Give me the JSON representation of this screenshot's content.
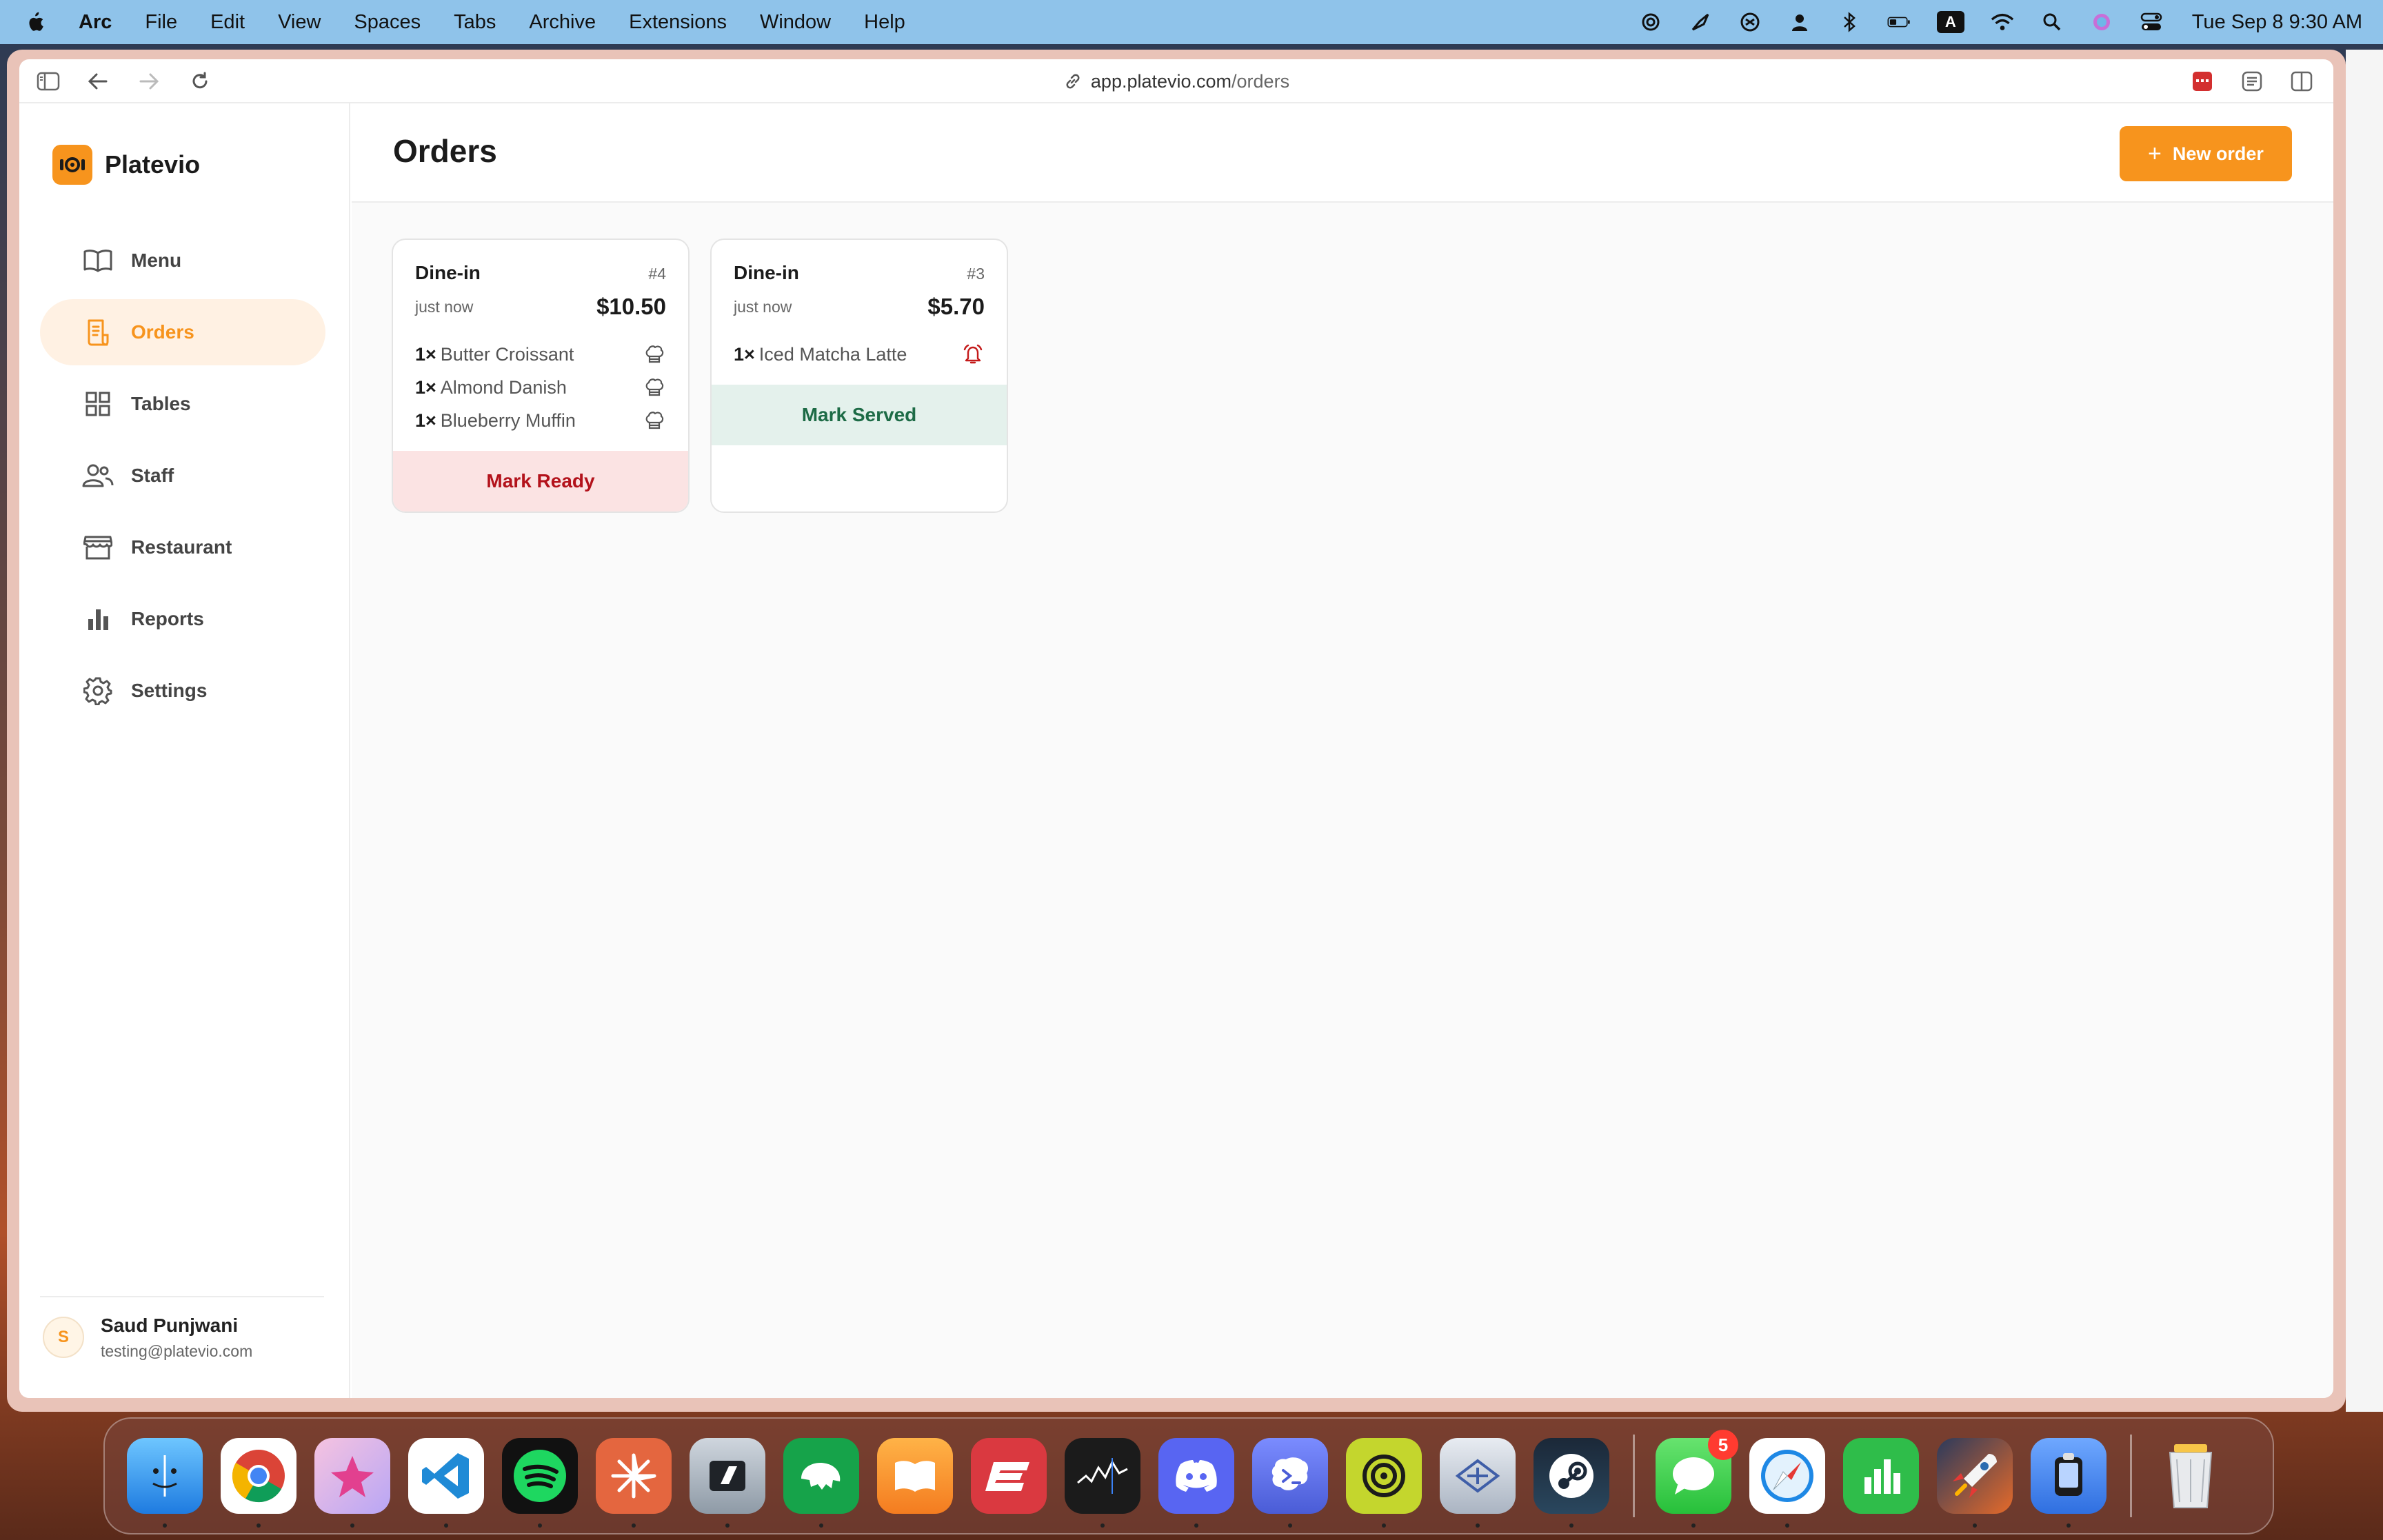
{
  "menubar": {
    "app_name": "Arc",
    "items": [
      "File",
      "Edit",
      "View",
      "Spaces",
      "Tabs",
      "Archive",
      "Extensions",
      "Window",
      "Help"
    ],
    "status_icons": [
      "openai-icon",
      "kite-icon",
      "chatgpt-icon",
      "user-icon",
      "bluetooth-icon",
      "battery-icon",
      "input-source-icon",
      "wifi-icon",
      "spotlight-icon",
      "siri-icon",
      "control-center-icon"
    ],
    "input_source": "A",
    "clock": "Tue Sep 8  9:30 AM"
  },
  "browser": {
    "url_host": "app.platevio.com",
    "url_path": "/orders"
  },
  "sidebar": {
    "brand": "Platevio",
    "items": [
      {
        "label": "Menu",
        "icon": "book-icon"
      },
      {
        "label": "Orders",
        "icon": "receipt-icon",
        "active": true
      },
      {
        "label": "Tables",
        "icon": "grid-icon"
      },
      {
        "label": "Staff",
        "icon": "people-icon"
      },
      {
        "label": "Restaurant",
        "icon": "storefront-icon"
      },
      {
        "label": "Reports",
        "icon": "bar-chart-icon"
      },
      {
        "label": "Settings",
        "icon": "gear-icon"
      }
    ],
    "user": {
      "initial": "S",
      "name": "Saud Punjwani",
      "email": "testing@platevio.com"
    }
  },
  "main": {
    "title": "Orders",
    "new_order_label": "New order",
    "orders": [
      {
        "type": "Dine-in",
        "number": "#4",
        "time": "just now",
        "total": "$10.50",
        "items": [
          {
            "qty": "1×",
            "name": "Butter Croissant",
            "status_icon": "chef-hat-icon"
          },
          {
            "qty": "1×",
            "name": "Almond Danish",
            "status_icon": "chef-hat-icon"
          },
          {
            "qty": "1×",
            "name": "Blueberry Muffin",
            "status_icon": "chef-hat-icon"
          }
        ],
        "action": "Mark Ready"
      },
      {
        "type": "Dine-in",
        "number": "#3",
        "time": "just now",
        "total": "$5.70",
        "items": [
          {
            "qty": "1×",
            "name": "Iced Matcha Latte",
            "status_icon": "bell-alert-icon"
          }
        ],
        "action": "Mark Served"
      }
    ]
  },
  "dock": {
    "apps": [
      "Finder",
      "Chrome",
      "Craft",
      "VS Code",
      "Spotify",
      "Claude",
      "Cursor",
      "TablePlus",
      "Books",
      "ExpressVPN",
      "Stocks",
      "Discord",
      "Termius",
      "Perplexity",
      "Xcode Instruments",
      "Steam",
      "Messages",
      "Safari",
      "Numbers",
      "Rocket",
      "Simulator",
      "Trash"
    ],
    "messages_badge": "5",
    "colors": {
      "accent": "#f7941d",
      "danger": "#b3121b",
      "success": "#1d6b46"
    }
  }
}
